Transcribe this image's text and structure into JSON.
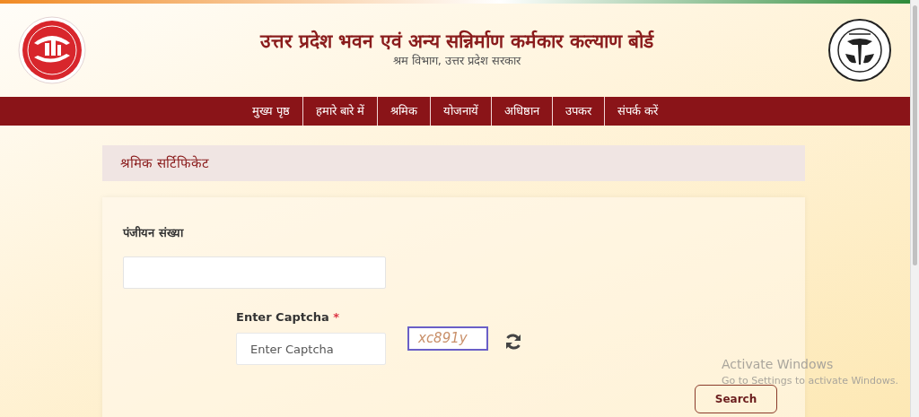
{
  "header": {
    "title": "उत्तर प्रदेश भवन एवं अन्य सन्निर्माण कर्मकार कल्याण बोर्ड",
    "subtitle": "श्रम विभाग, उत्तर प्रदेश सरकार"
  },
  "nav": {
    "items": [
      {
        "label": "मुख्य पृष्ठ"
      },
      {
        "label": "हमारे बारे में"
      },
      {
        "label": "श्रमिक"
      },
      {
        "label": "योजनायें"
      },
      {
        "label": "अधिष्ठान"
      },
      {
        "label": "उपकर"
      },
      {
        "label": "संपर्क करें"
      }
    ]
  },
  "page_title": "श्रमिक सर्टिफिकेट",
  "form": {
    "registration": {
      "label": "पंजीयन संख्या"
    },
    "captcha": {
      "label": "Enter Captcha",
      "required_mark": "*",
      "placeholder": "Enter Captcha",
      "code": "xc891y"
    },
    "search_button": "Search"
  },
  "os_notice": {
    "title": "Activate Windows",
    "text": "Go to Settings to activate Windows."
  }
}
